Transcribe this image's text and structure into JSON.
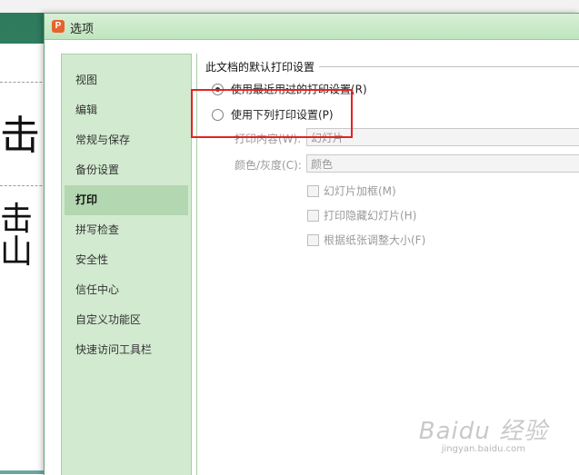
{
  "background": {
    "glyph1": "击",
    "glyph2": "击山"
  },
  "dialog": {
    "app_icon": "P",
    "title": "选项"
  },
  "sidebar": {
    "items": [
      {
        "label": "视图"
      },
      {
        "label": "编辑"
      },
      {
        "label": "常规与保存"
      },
      {
        "label": "备份设置"
      },
      {
        "label": "打印"
      },
      {
        "label": "拼写检查"
      },
      {
        "label": "安全性"
      },
      {
        "label": "信任中心"
      },
      {
        "label": "自定义功能区"
      },
      {
        "label": "快速访问工具栏"
      }
    ],
    "active_index": 4
  },
  "print": {
    "group_title": "此文档的默认打印设置",
    "radio_recent": "使用最近用过的打印设置(R)",
    "radio_following": "使用下列打印设置(P)",
    "print_content_label": "打印内容(W):",
    "print_content_value": "幻灯片",
    "color_label": "颜色/灰度(C):",
    "color_value": "颜色",
    "check_frame": "幻灯片加框(M)",
    "check_hidden": "打印隐藏幻灯片(H)",
    "check_fit": "根据纸张调整大小(F)"
  },
  "watermark": {
    "main": "Baidu 经验",
    "sub": "jingyan.baidu.com"
  },
  "colors": {
    "title_bar": "#c8ebc8",
    "sidebar_bg": "#d2ead0",
    "active_item": "#b3d7b0",
    "highlight": "#e52222",
    "app_icon": "#e8632c"
  }
}
